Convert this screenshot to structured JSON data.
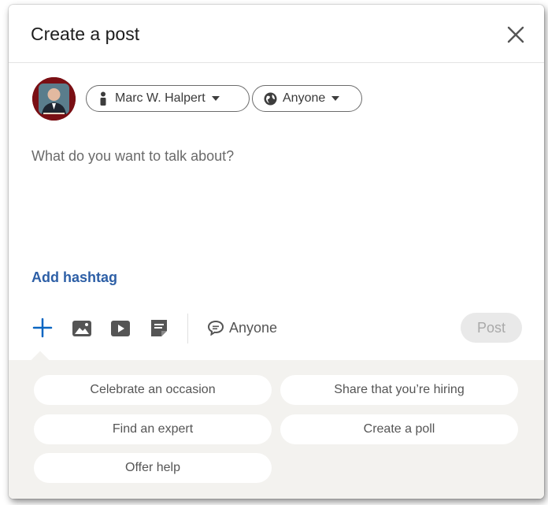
{
  "dialog": {
    "title": "Create a post"
  },
  "author": {
    "name": "Marc W. Halpert"
  },
  "audience": {
    "label": "Anyone"
  },
  "composer": {
    "placeholder": "What do you want to talk about?",
    "hashtag_link": "Add hashtag"
  },
  "toolbar": {
    "icons": [
      "plus-icon",
      "photo-icon",
      "video-icon",
      "document-icon"
    ],
    "comment_control_label": "Anyone",
    "post_label": "Post"
  },
  "suggestions": {
    "items": [
      "Celebrate an occasion",
      "Share that you’re hiring",
      "Find an expert",
      "Create a poll",
      "Offer help"
    ]
  },
  "colors": {
    "link_blue": "#2d5fa6",
    "accent_blue": "#0a66c2",
    "suggestion_bg": "#f3f2ef",
    "disabled_button_bg": "#e9e9e9",
    "avatar_bg": "#7a0f14"
  }
}
